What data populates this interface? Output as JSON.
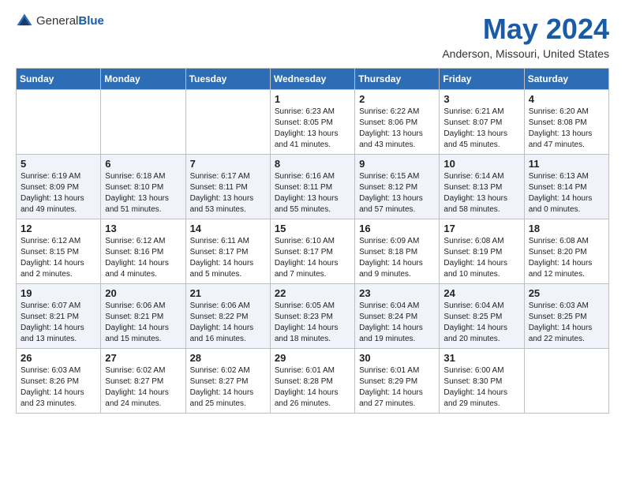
{
  "header": {
    "logo_general": "General",
    "logo_blue": "Blue",
    "month": "May 2024",
    "location": "Anderson, Missouri, United States"
  },
  "weekdays": [
    "Sunday",
    "Monday",
    "Tuesday",
    "Wednesday",
    "Thursday",
    "Friday",
    "Saturday"
  ],
  "weeks": [
    [
      {
        "day": "",
        "sunrise": "",
        "sunset": "",
        "daylight": ""
      },
      {
        "day": "",
        "sunrise": "",
        "sunset": "",
        "daylight": ""
      },
      {
        "day": "",
        "sunrise": "",
        "sunset": "",
        "daylight": ""
      },
      {
        "day": "1",
        "sunrise": "Sunrise: 6:23 AM",
        "sunset": "Sunset: 8:05 PM",
        "daylight": "Daylight: 13 hours and 41 minutes."
      },
      {
        "day": "2",
        "sunrise": "Sunrise: 6:22 AM",
        "sunset": "Sunset: 8:06 PM",
        "daylight": "Daylight: 13 hours and 43 minutes."
      },
      {
        "day": "3",
        "sunrise": "Sunrise: 6:21 AM",
        "sunset": "Sunset: 8:07 PM",
        "daylight": "Daylight: 13 hours and 45 minutes."
      },
      {
        "day": "4",
        "sunrise": "Sunrise: 6:20 AM",
        "sunset": "Sunset: 8:08 PM",
        "daylight": "Daylight: 13 hours and 47 minutes."
      }
    ],
    [
      {
        "day": "5",
        "sunrise": "Sunrise: 6:19 AM",
        "sunset": "Sunset: 8:09 PM",
        "daylight": "Daylight: 13 hours and 49 minutes."
      },
      {
        "day": "6",
        "sunrise": "Sunrise: 6:18 AM",
        "sunset": "Sunset: 8:10 PM",
        "daylight": "Daylight: 13 hours and 51 minutes."
      },
      {
        "day": "7",
        "sunrise": "Sunrise: 6:17 AM",
        "sunset": "Sunset: 8:11 PM",
        "daylight": "Daylight: 13 hours and 53 minutes."
      },
      {
        "day": "8",
        "sunrise": "Sunrise: 6:16 AM",
        "sunset": "Sunset: 8:11 PM",
        "daylight": "Daylight: 13 hours and 55 minutes."
      },
      {
        "day": "9",
        "sunrise": "Sunrise: 6:15 AM",
        "sunset": "Sunset: 8:12 PM",
        "daylight": "Daylight: 13 hours and 57 minutes."
      },
      {
        "day": "10",
        "sunrise": "Sunrise: 6:14 AM",
        "sunset": "Sunset: 8:13 PM",
        "daylight": "Daylight: 13 hours and 58 minutes."
      },
      {
        "day": "11",
        "sunrise": "Sunrise: 6:13 AM",
        "sunset": "Sunset: 8:14 PM",
        "daylight": "Daylight: 14 hours and 0 minutes."
      }
    ],
    [
      {
        "day": "12",
        "sunrise": "Sunrise: 6:12 AM",
        "sunset": "Sunset: 8:15 PM",
        "daylight": "Daylight: 14 hours and 2 minutes."
      },
      {
        "day": "13",
        "sunrise": "Sunrise: 6:12 AM",
        "sunset": "Sunset: 8:16 PM",
        "daylight": "Daylight: 14 hours and 4 minutes."
      },
      {
        "day": "14",
        "sunrise": "Sunrise: 6:11 AM",
        "sunset": "Sunset: 8:17 PM",
        "daylight": "Daylight: 14 hours and 5 minutes."
      },
      {
        "day": "15",
        "sunrise": "Sunrise: 6:10 AM",
        "sunset": "Sunset: 8:17 PM",
        "daylight": "Daylight: 14 hours and 7 minutes."
      },
      {
        "day": "16",
        "sunrise": "Sunrise: 6:09 AM",
        "sunset": "Sunset: 8:18 PM",
        "daylight": "Daylight: 14 hours and 9 minutes."
      },
      {
        "day": "17",
        "sunrise": "Sunrise: 6:08 AM",
        "sunset": "Sunset: 8:19 PM",
        "daylight": "Daylight: 14 hours and 10 minutes."
      },
      {
        "day": "18",
        "sunrise": "Sunrise: 6:08 AM",
        "sunset": "Sunset: 8:20 PM",
        "daylight": "Daylight: 14 hours and 12 minutes."
      }
    ],
    [
      {
        "day": "19",
        "sunrise": "Sunrise: 6:07 AM",
        "sunset": "Sunset: 8:21 PM",
        "daylight": "Daylight: 14 hours and 13 minutes."
      },
      {
        "day": "20",
        "sunrise": "Sunrise: 6:06 AM",
        "sunset": "Sunset: 8:21 PM",
        "daylight": "Daylight: 14 hours and 15 minutes."
      },
      {
        "day": "21",
        "sunrise": "Sunrise: 6:06 AM",
        "sunset": "Sunset: 8:22 PM",
        "daylight": "Daylight: 14 hours and 16 minutes."
      },
      {
        "day": "22",
        "sunrise": "Sunrise: 6:05 AM",
        "sunset": "Sunset: 8:23 PM",
        "daylight": "Daylight: 14 hours and 18 minutes."
      },
      {
        "day": "23",
        "sunrise": "Sunrise: 6:04 AM",
        "sunset": "Sunset: 8:24 PM",
        "daylight": "Daylight: 14 hours and 19 minutes."
      },
      {
        "day": "24",
        "sunrise": "Sunrise: 6:04 AM",
        "sunset": "Sunset: 8:25 PM",
        "daylight": "Daylight: 14 hours and 20 minutes."
      },
      {
        "day": "25",
        "sunrise": "Sunrise: 6:03 AM",
        "sunset": "Sunset: 8:25 PM",
        "daylight": "Daylight: 14 hours and 22 minutes."
      }
    ],
    [
      {
        "day": "26",
        "sunrise": "Sunrise: 6:03 AM",
        "sunset": "Sunset: 8:26 PM",
        "daylight": "Daylight: 14 hours and 23 minutes."
      },
      {
        "day": "27",
        "sunrise": "Sunrise: 6:02 AM",
        "sunset": "Sunset: 8:27 PM",
        "daylight": "Daylight: 14 hours and 24 minutes."
      },
      {
        "day": "28",
        "sunrise": "Sunrise: 6:02 AM",
        "sunset": "Sunset: 8:27 PM",
        "daylight": "Daylight: 14 hours and 25 minutes."
      },
      {
        "day": "29",
        "sunrise": "Sunrise: 6:01 AM",
        "sunset": "Sunset: 8:28 PM",
        "daylight": "Daylight: 14 hours and 26 minutes."
      },
      {
        "day": "30",
        "sunrise": "Sunrise: 6:01 AM",
        "sunset": "Sunset: 8:29 PM",
        "daylight": "Daylight: 14 hours and 27 minutes."
      },
      {
        "day": "31",
        "sunrise": "Sunrise: 6:00 AM",
        "sunset": "Sunset: 8:30 PM",
        "daylight": "Daylight: 14 hours and 29 minutes."
      },
      {
        "day": "",
        "sunrise": "",
        "sunset": "",
        "daylight": ""
      }
    ]
  ]
}
